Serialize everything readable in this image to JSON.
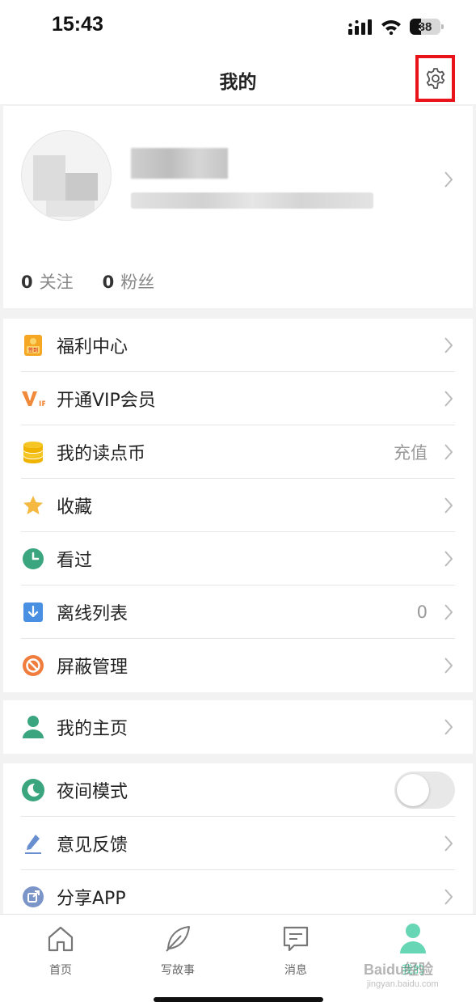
{
  "status_bar": {
    "time": "15:43",
    "battery": "38"
  },
  "nav": {
    "title": "我的"
  },
  "profile": {
    "stats": [
      {
        "count": "0",
        "label": "关注"
      },
      {
        "count": "0",
        "label": "粉丝"
      }
    ]
  },
  "menu_group_1": [
    {
      "label": "福利中心",
      "icon": "welfare-icon"
    },
    {
      "label": "开通VIP会员",
      "icon": "vip-icon"
    },
    {
      "label": "我的读点币",
      "icon": "coins-icon",
      "value": "充值"
    },
    {
      "label": "收藏",
      "icon": "star-icon"
    },
    {
      "label": "看过",
      "icon": "clock-icon"
    },
    {
      "label": "离线列表",
      "icon": "download-icon",
      "value": "0"
    },
    {
      "label": "屏蔽管理",
      "icon": "block-icon"
    }
  ],
  "menu_group_2": [
    {
      "label": "我的主页",
      "icon": "person-icon"
    }
  ],
  "menu_group_3": [
    {
      "label": "夜间模式",
      "icon": "moon-icon",
      "toggle": false
    },
    {
      "label": "意见反馈",
      "icon": "pencil-icon"
    },
    {
      "label": "分享APP",
      "icon": "share-icon"
    }
  ],
  "tab_bar": [
    {
      "label": "首页",
      "icon": "home-icon"
    },
    {
      "label": "写故事",
      "icon": "feather-icon"
    },
    {
      "label": "消息",
      "icon": "message-icon"
    },
    {
      "label": "我的",
      "icon": "user-icon",
      "active": true
    }
  ],
  "watermark": {
    "main": "Baidu经验",
    "sub": "jingyan.baidu.com"
  },
  "colors": {
    "accent": "#4bcb9f",
    "highlight_box": "#e8141a"
  }
}
